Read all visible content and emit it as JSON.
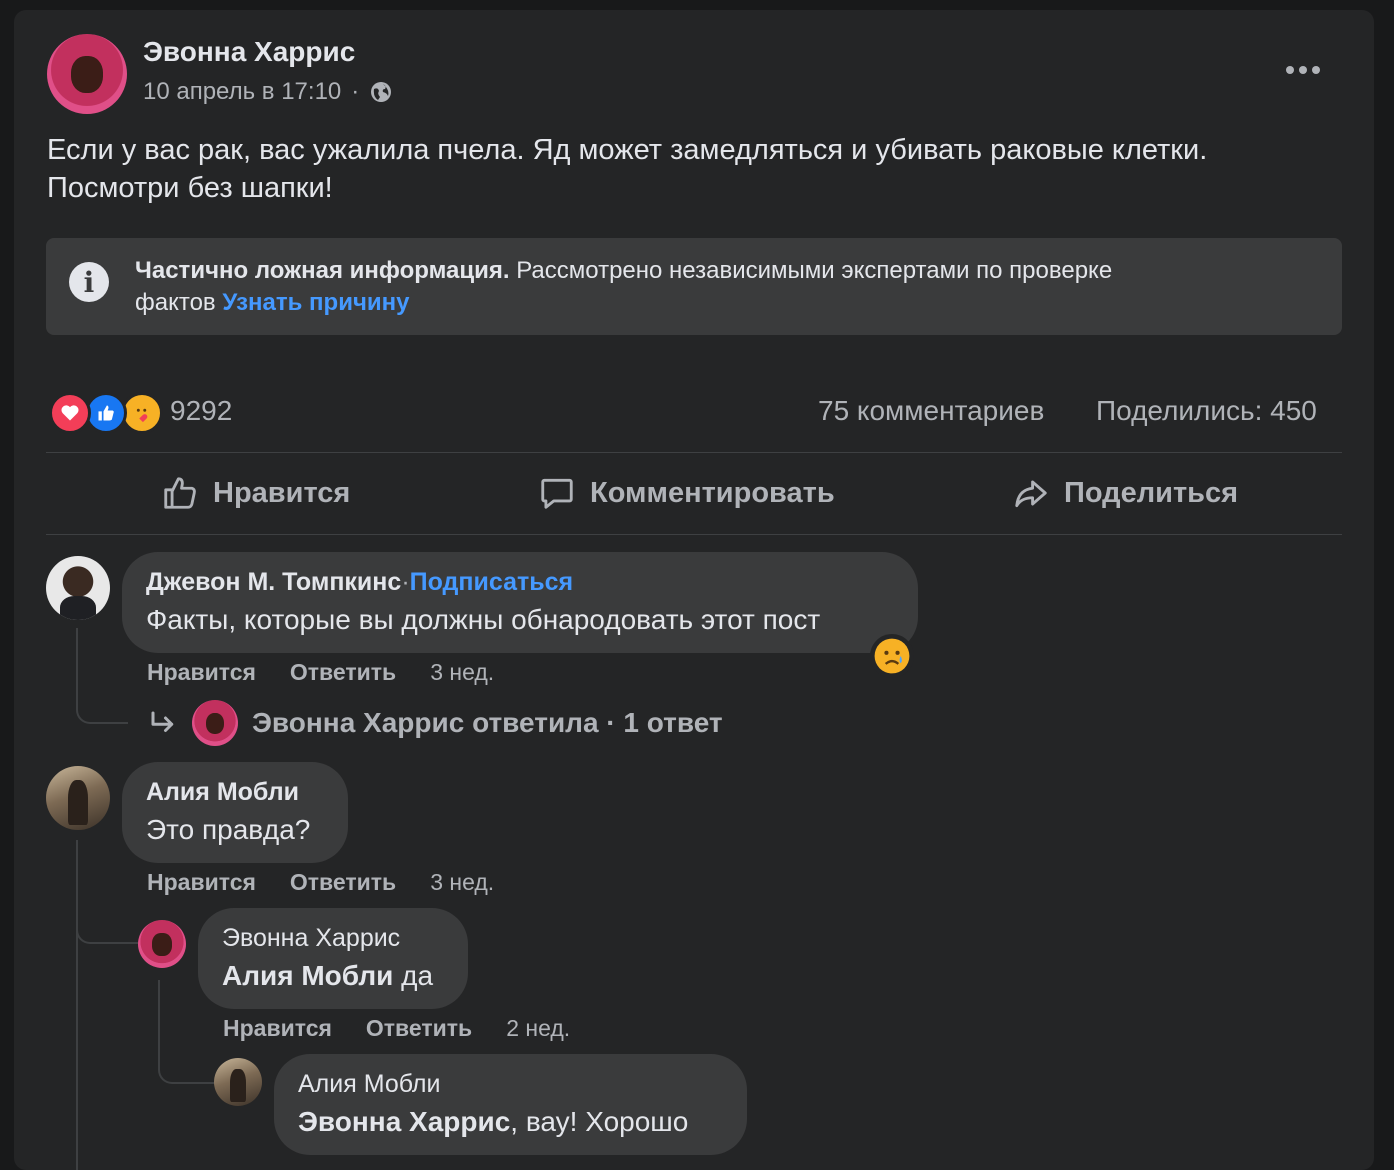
{
  "post": {
    "author": "Эвонна Харрис",
    "timestamp": "10 апрель в 17:10",
    "audience_icon": "globe-icon",
    "text_line1": "Если у вас рак, вас ужалила пчела. Яд может замедляться и убивать раковые клетки.",
    "text_line2": "Посмотри без шапки!"
  },
  "fact_check": {
    "icon": "info-icon",
    "bold_label": "Частично ложная информация.",
    "text": " Рассмотрено независимыми экспертами по проверке",
    "text2": "фактов ",
    "link": "Узнать причину"
  },
  "stats": {
    "reactions_count": "9292",
    "reaction_icons": [
      "heart-icon",
      "thumbs-up-icon",
      "care-icon"
    ],
    "comments": "75 комментариев",
    "shares": "Поделились: 450"
  },
  "actions": {
    "like": "Нравится",
    "comment": "Комментировать",
    "share": "Поделиться"
  },
  "comments": [
    {
      "author": "Джевон М. Томпкинс",
      "follow": "Подписаться",
      "separator": "·",
      "text": "Факты, которые вы должны обнародовать этот пост",
      "reaction": "sad-icon",
      "like": "Нравится",
      "reply": "Ответить",
      "time": "3 нед.",
      "replies_summary": "Эвонна Харрис ответила · 1 ответ"
    },
    {
      "author": "Алия Мобли",
      "text": "Это правда?",
      "like": "Нравится",
      "reply": "Ответить",
      "time": "3 нед.",
      "replies": [
        {
          "author": "Эвонна Харрис",
          "mention": "Алия Мобли",
          "text": " да",
          "like": "Нравится",
          "reply": "Ответить",
          "time": "2 нед."
        },
        {
          "author": "Алия Мобли",
          "mention": "Эвонна Харрис",
          "text": ", вау! Хорошо"
        }
      ]
    }
  ],
  "colors": {
    "background": "#18191a",
    "card": "#242526",
    "bubble": "#3a3b3c",
    "link": "#4599ff",
    "secondary_text": "#b0b3b8"
  }
}
